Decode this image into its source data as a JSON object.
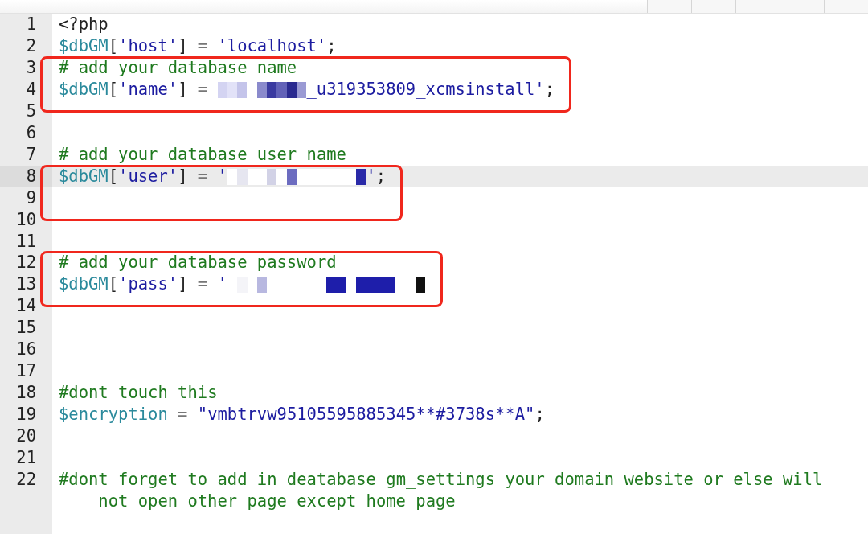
{
  "toolbar": {
    "buttons": [
      {
        "kind": "button"
      },
      {
        "kind": "button"
      },
      {
        "kind": "button"
      },
      {
        "kind": "button"
      },
      {
        "kind": "button"
      }
    ]
  },
  "editor": {
    "groups": [
      {
        "boxed": false,
        "lines": [
          {
            "number": "1",
            "current": false,
            "tokens": [
              {
                "kind": "plain",
                "text": "<?php"
              }
            ]
          },
          {
            "number": "2",
            "current": false,
            "tokens": [
              {
                "kind": "var",
                "text": "$dbGM"
              },
              {
                "kind": "plain",
                "text": "["
              },
              {
                "kind": "str",
                "text": "'host'"
              },
              {
                "kind": "plain",
                "text": "]"
              },
              {
                "kind": "op",
                "text": " = "
              },
              {
                "kind": "str",
                "text": "'localhost'"
              },
              {
                "kind": "plain",
                "text": ";"
              }
            ]
          }
        ]
      },
      {
        "boxed": true,
        "lines": [
          {
            "number": "3",
            "current": false,
            "tokens": [
              {
                "kind": "comment",
                "text": "# add your database name"
              }
            ]
          },
          {
            "number": "4",
            "current": false,
            "tokens": [
              {
                "kind": "var",
                "text": "$dbGM"
              },
              {
                "kind": "plain",
                "text": "["
              },
              {
                "kind": "str",
                "text": "'name'"
              },
              {
                "kind": "plain",
                "text": "]"
              },
              {
                "kind": "op",
                "text": " = "
              },
              {
                "kind": "redacted",
                "blocks": [
                  {
                    "color": "#d4d4f2"
                  },
                  {
                    "color": "#e2e2f8"
                  },
                  {
                    "color": "#c4c4ea"
                  },
                  {
                    "color": "#ffffff"
                  },
                  {
                    "color": "#8a8acc"
                  },
                  {
                    "color": "#3a3aa0"
                  },
                  {
                    "color": "#6262b8"
                  },
                  {
                    "color": "#2a2a90"
                  },
                  {
                    "color": "#9a9ad4"
                  }
                ]
              },
              {
                "kind": "str",
                "text": "_u319353809_xcmsinstall'"
              },
              {
                "kind": "plain",
                "text": ";"
              }
            ]
          }
        ]
      },
      {
        "boxed": false,
        "lines": [
          {
            "number": "5",
            "current": false
          },
          {
            "number": "6",
            "current": false
          },
          {
            "number": "7",
            "current": false,
            "tokens": [
              {
                "kind": "comment",
                "text": "# add your database user name"
              }
            ]
          }
        ]
      },
      {
        "boxed": true,
        "lines": [
          {
            "number": "8",
            "current": true,
            "tokens": [
              {
                "kind": "var",
                "text": "$dbGM"
              },
              {
                "kind": "plain",
                "text": "["
              },
              {
                "kind": "str",
                "text": "'user'"
              },
              {
                "kind": "plain",
                "text": "]"
              },
              {
                "kind": "op",
                "text": " = "
              },
              {
                "kind": "str",
                "text": "'"
              },
              {
                "kind": "redacted",
                "blocks": [
                  {
                    "color": "#ffffff"
                  },
                  {
                    "color": "#e6e6f0"
                  },
                  {
                    "color": "#ffffff"
                  },
                  {
                    "color": "#ffffff"
                  },
                  {
                    "color": "#d2d2e6"
                  },
                  {
                    "color": "#ffffff"
                  },
                  {
                    "color": "#6c6cc0"
                  },
                  {
                    "color": "#ffffff"
                  },
                  {
                    "color": "#ffffff"
                  },
                  {
                    "color": "#ffffff"
                  },
                  {
                    "color": "#ffffff"
                  },
                  {
                    "color": "#ffffff"
                  },
                  {
                    "color": "#ffffff"
                  },
                  {
                    "color": "#2a2aa8"
                  }
                ]
              },
              {
                "kind": "str",
                "text": "'"
              },
              {
                "kind": "plain",
                "text": ";"
              }
            ]
          },
          {
            "number": "9",
            "current": false
          }
        ]
      },
      {
        "boxed": false,
        "lines": [
          {
            "number": "10",
            "current": false
          },
          {
            "number": "11",
            "current": false
          }
        ]
      },
      {
        "boxed": true,
        "lines": [
          {
            "number": "12",
            "current": false,
            "tokens": [
              {
                "kind": "comment",
                "text": "# add your database password"
              }
            ]
          },
          {
            "number": "13",
            "current": false,
            "tokens": [
              {
                "kind": "var",
                "text": "$dbGM"
              },
              {
                "kind": "plain",
                "text": "["
              },
              {
                "kind": "str",
                "text": "'pass'"
              },
              {
                "kind": "plain",
                "text": "]"
              },
              {
                "kind": "op",
                "text": " = "
              },
              {
                "kind": "str",
                "text": "'"
              },
              {
                "kind": "redacted",
                "blocks": [
                  {
                    "color": "#ffffff"
                  },
                  {
                    "color": "#f4f4f8"
                  },
                  {
                    "color": "#ffffff"
                  },
                  {
                    "color": "#b8b8e0"
                  },
                  {
                    "color": "#ffffff"
                  },
                  {
                    "color": "#ffffff"
                  },
                  {
                    "color": "#ffffff"
                  },
                  {
                    "color": "#ffffff"
                  },
                  {
                    "color": "#ffffff"
                  },
                  {
                    "color": "#ffffff"
                  },
                  {
                    "color": "#1e1eaa"
                  },
                  {
                    "color": "#1e1eaa"
                  },
                  {
                    "color": "#ffffff"
                  },
                  {
                    "color": "#1e1eaa"
                  },
                  {
                    "color": "#1e1eaa"
                  },
                  {
                    "color": "#1e1eaa"
                  },
                  {
                    "color": "#1e1eaa"
                  },
                  {
                    "color": "#ffffff"
                  },
                  {
                    "color": "#ffffff"
                  },
                  {
                    "color": "#111111"
                  }
                ]
              }
            ]
          }
        ]
      },
      {
        "boxed": false,
        "lines": [
          {
            "number": "14",
            "current": false
          },
          {
            "number": "15",
            "current": false
          },
          {
            "number": "16",
            "current": false
          },
          {
            "number": "17",
            "current": false
          },
          {
            "number": "18",
            "current": false,
            "tokens": [
              {
                "kind": "comment",
                "text": "#dont touch this"
              }
            ]
          },
          {
            "number": "19",
            "current": false,
            "tokens": [
              {
                "kind": "var",
                "text": "$encryption"
              },
              {
                "kind": "op",
                "text": " = "
              },
              {
                "kind": "str",
                "text": "\"vmbtrvw95105595885345**#3738s**A\""
              },
              {
                "kind": "plain",
                "text": ";"
              }
            ]
          },
          {
            "number": "20",
            "current": false
          },
          {
            "number": "21",
            "current": false
          },
          {
            "number": "22",
            "current": false,
            "tokens": [
              {
                "kind": "comment",
                "text": "#dont forget to add in deatabase gm_settings your domain website or else will not open other page except home page"
              }
            ]
          }
        ]
      }
    ]
  }
}
